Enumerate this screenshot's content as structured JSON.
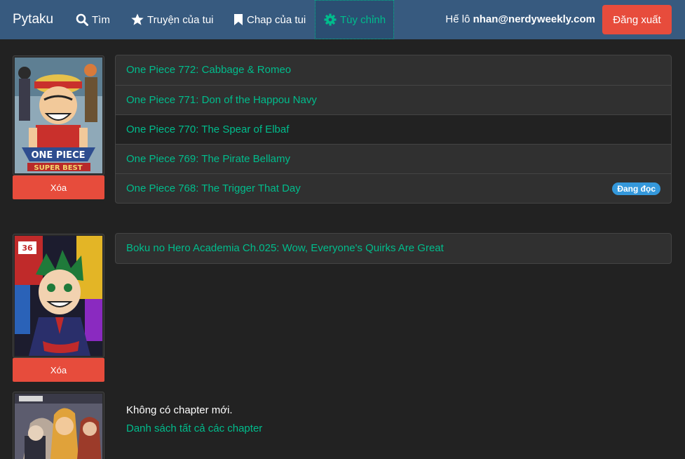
{
  "nav": {
    "brand": "Pytaku",
    "search_label": "Tìm",
    "my_manga_label": "Truyện của tui",
    "my_chapters_label": "Chap của tui",
    "settings_label": "Tùy chỉnh",
    "greeting_prefix": "Hế lô ",
    "user_email": "nhan@nerdyweekly.com",
    "logout_label": "Đăng xuất"
  },
  "series": [
    {
      "delete_label": "Xóa",
      "chapters": [
        {
          "title": "One Piece 772: Cabbage & Romeo",
          "badge": ""
        },
        {
          "title": "One Piece 771: Don of the Happou Navy",
          "badge": ""
        },
        {
          "title": "One Piece 770: The Spear of Elbaf",
          "badge": ""
        },
        {
          "title": "One Piece 769: The Pirate Bellamy",
          "badge": ""
        },
        {
          "title": "One Piece 768: The Trigger That Day",
          "badge": "Đang đọc"
        }
      ]
    },
    {
      "delete_label": "Xóa",
      "chapters": [
        {
          "title": "Boku no Hero Academia Ch.025: Wow, Everyone's Quirks Are Great",
          "badge": ""
        }
      ]
    },
    {
      "no_new_chapters": "Không có chapter mới.",
      "all_chapters_link": "Danh sách tất cả các chapter"
    }
  ],
  "colors": {
    "navbar": "#375a7f",
    "background": "#222222",
    "accent": "#00bc8c",
    "danger": "#e74c3c",
    "badge": "#3498db"
  },
  "icons": {
    "search": "search-icon",
    "star": "star-icon",
    "bookmark": "bookmark-icon",
    "gear": "gear-icon"
  }
}
